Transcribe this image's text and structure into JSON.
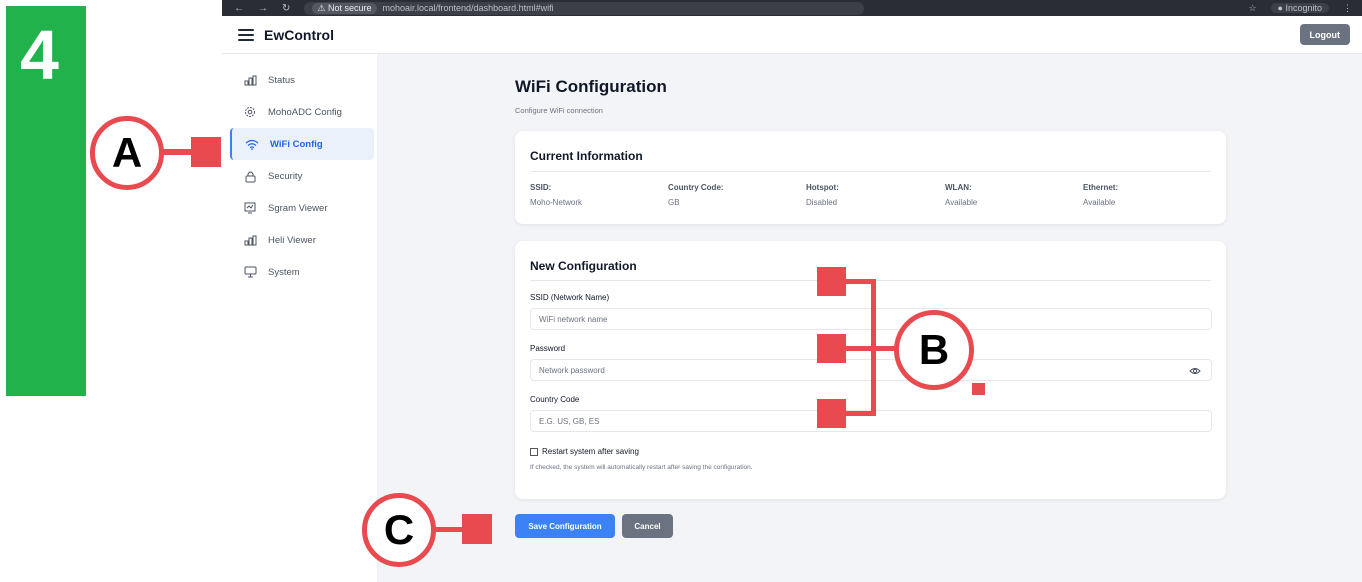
{
  "step_label": "4",
  "browser": {
    "not_secure": "Not secure",
    "url": "mohoair.local/frontend/dashboard.html#wifi",
    "incognito": "Incognito"
  },
  "header": {
    "brand": "EwControl",
    "logout": "Logout"
  },
  "sidebar": {
    "items": [
      {
        "label": "Status",
        "icon": "bar-chart-icon",
        "active": false
      },
      {
        "label": "MohoADC Config",
        "icon": "gear-icon",
        "active": false
      },
      {
        "label": "WiFi Config",
        "icon": "wifi-icon",
        "active": true
      },
      {
        "label": "Security",
        "icon": "lock-icon",
        "active": false
      },
      {
        "label": "Sgram Viewer",
        "icon": "spectrogram-icon",
        "active": false
      },
      {
        "label": "Heli Viewer",
        "icon": "bar-chart-icon",
        "active": false
      },
      {
        "label": "System",
        "icon": "monitor-icon",
        "active": false
      }
    ]
  },
  "page": {
    "title": "WiFi Configuration",
    "subtitle": "Configure WiFi connection"
  },
  "current": {
    "title": "Current Information",
    "fields": [
      {
        "key": "SSID:",
        "value": "Moho-Network"
      },
      {
        "key": "Country Code:",
        "value": "GB"
      },
      {
        "key": "Hotspot:",
        "value": "Disabled"
      },
      {
        "key": "WLAN:",
        "value": "Available"
      },
      {
        "key": "Ethernet:",
        "value": "Available"
      }
    ]
  },
  "newconfig": {
    "title": "New Configuration",
    "ssid_label": "SSID (Network Name)",
    "ssid_placeholder": "WiFi network name",
    "ssid_value": "",
    "password_label": "Password",
    "password_placeholder": "Network password",
    "password_value": "",
    "country_label": "Country Code",
    "country_placeholder": "E.G. US, GB, ES",
    "country_value": "",
    "restart_label": "Restart system after saving",
    "restart_checked": false,
    "restart_hint": "If checked, the system will automatically restart after saving the configuration."
  },
  "actions": {
    "save": "Save Configuration",
    "cancel": "Cancel"
  },
  "annotations": {
    "a": "A",
    "b": "B",
    "c": "C"
  },
  "colors": {
    "accent": "#3b82f6",
    "annotation": "#e84a4f",
    "step_green": "#22b24c",
    "secondary_button": "#6b7280"
  }
}
